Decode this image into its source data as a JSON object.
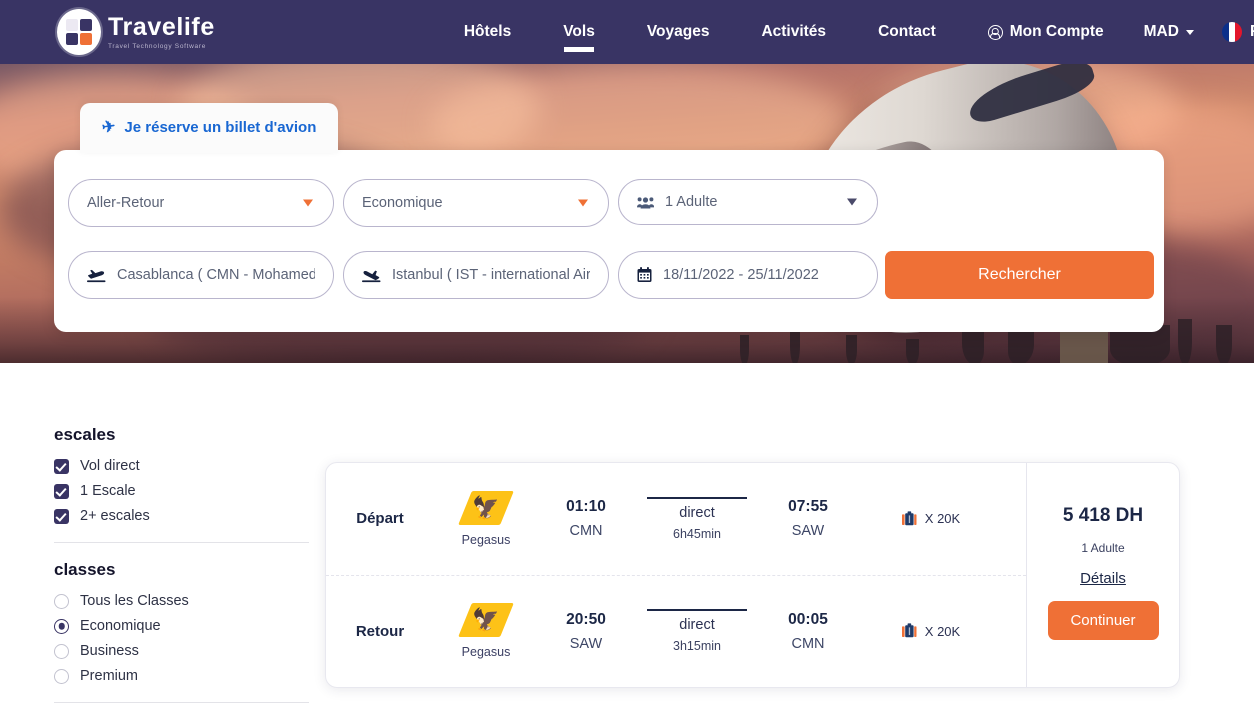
{
  "brand": {
    "name": "Travelife",
    "tagline": "Travel Technology Software",
    "logo_icon": "travelife-logo-icon",
    "colors": {
      "navy": "#393464",
      "orange": "#ef7036",
      "yellow": "#fdc217"
    }
  },
  "nav": {
    "items": [
      {
        "label": "Hôtels",
        "active": false
      },
      {
        "label": "Vols",
        "active": true
      },
      {
        "label": "Voyages",
        "active": false
      },
      {
        "label": "Activités",
        "active": false
      },
      {
        "label": "Contact",
        "active": false
      }
    ],
    "account": {
      "label": "Mon Compte",
      "icon": "user-circle-icon"
    },
    "currency": {
      "value": "MAD",
      "icon": "chevron-down-icon"
    },
    "language": {
      "value": "FR",
      "icon": "flag-fr-icon"
    }
  },
  "hero": {
    "tab": {
      "label": "Je réserve un billet d'avion",
      "icon": "airplane-icon"
    }
  },
  "search": {
    "trip_type": {
      "value": "Aller-Retour",
      "icon": "chevron-down-icon"
    },
    "cabin_class": {
      "value": "Economique",
      "icon": "chevron-down-icon"
    },
    "passengers": {
      "value": "1 Adulte",
      "icon": "users-icon"
    },
    "origin": {
      "value": "Casablanca ( CMN - Mohamed V Airport )",
      "icon": "plane-departure-icon"
    },
    "destination": {
      "value": "Istanbul ( IST - international Airport )",
      "icon": "plane-arrival-icon"
    },
    "dates": {
      "value": "18/11/2022 - 25/11/2022",
      "icon": "calendar-icon"
    },
    "submit_label": "Rechercher"
  },
  "filters": {
    "stops": {
      "title": "escales",
      "options": [
        {
          "label": "Vol direct",
          "checked": true
        },
        {
          "label": "1 Escale",
          "checked": true
        },
        {
          "label": "2+ escales",
          "checked": true
        }
      ]
    },
    "classes": {
      "title": "classes",
      "options": [
        {
          "label": "Tous les Classes",
          "selected": false
        },
        {
          "label": "Economique",
          "selected": true
        },
        {
          "label": "Business",
          "selected": false
        },
        {
          "label": "Premium",
          "selected": false
        }
      ]
    }
  },
  "results": [
    {
      "legs": [
        {
          "direction": "Départ",
          "airline": "Pegasus",
          "airline_icon": "pegasus-logo-icon",
          "depart_time": "01:10",
          "depart_code": "CMN",
          "stop_type": "direct",
          "duration": "6h45min",
          "arrive_time": "07:55",
          "arrive_code": "SAW",
          "baggage": "X 20K",
          "baggage_icon": "suitcase-icon"
        },
        {
          "direction": "Retour",
          "airline": "Pegasus",
          "airline_icon": "pegasus-logo-icon",
          "depart_time": "20:50",
          "depart_code": "SAW",
          "stop_type": "direct",
          "duration": "3h15min",
          "arrive_time": "00:05",
          "arrive_code": "CMN",
          "baggage": "X 20K",
          "baggage_icon": "suitcase-icon"
        }
      ],
      "price": "5 418 DH",
      "price_sub": "1 Adulte",
      "details_label": "Détails",
      "continue_label": "Continuer"
    }
  ]
}
